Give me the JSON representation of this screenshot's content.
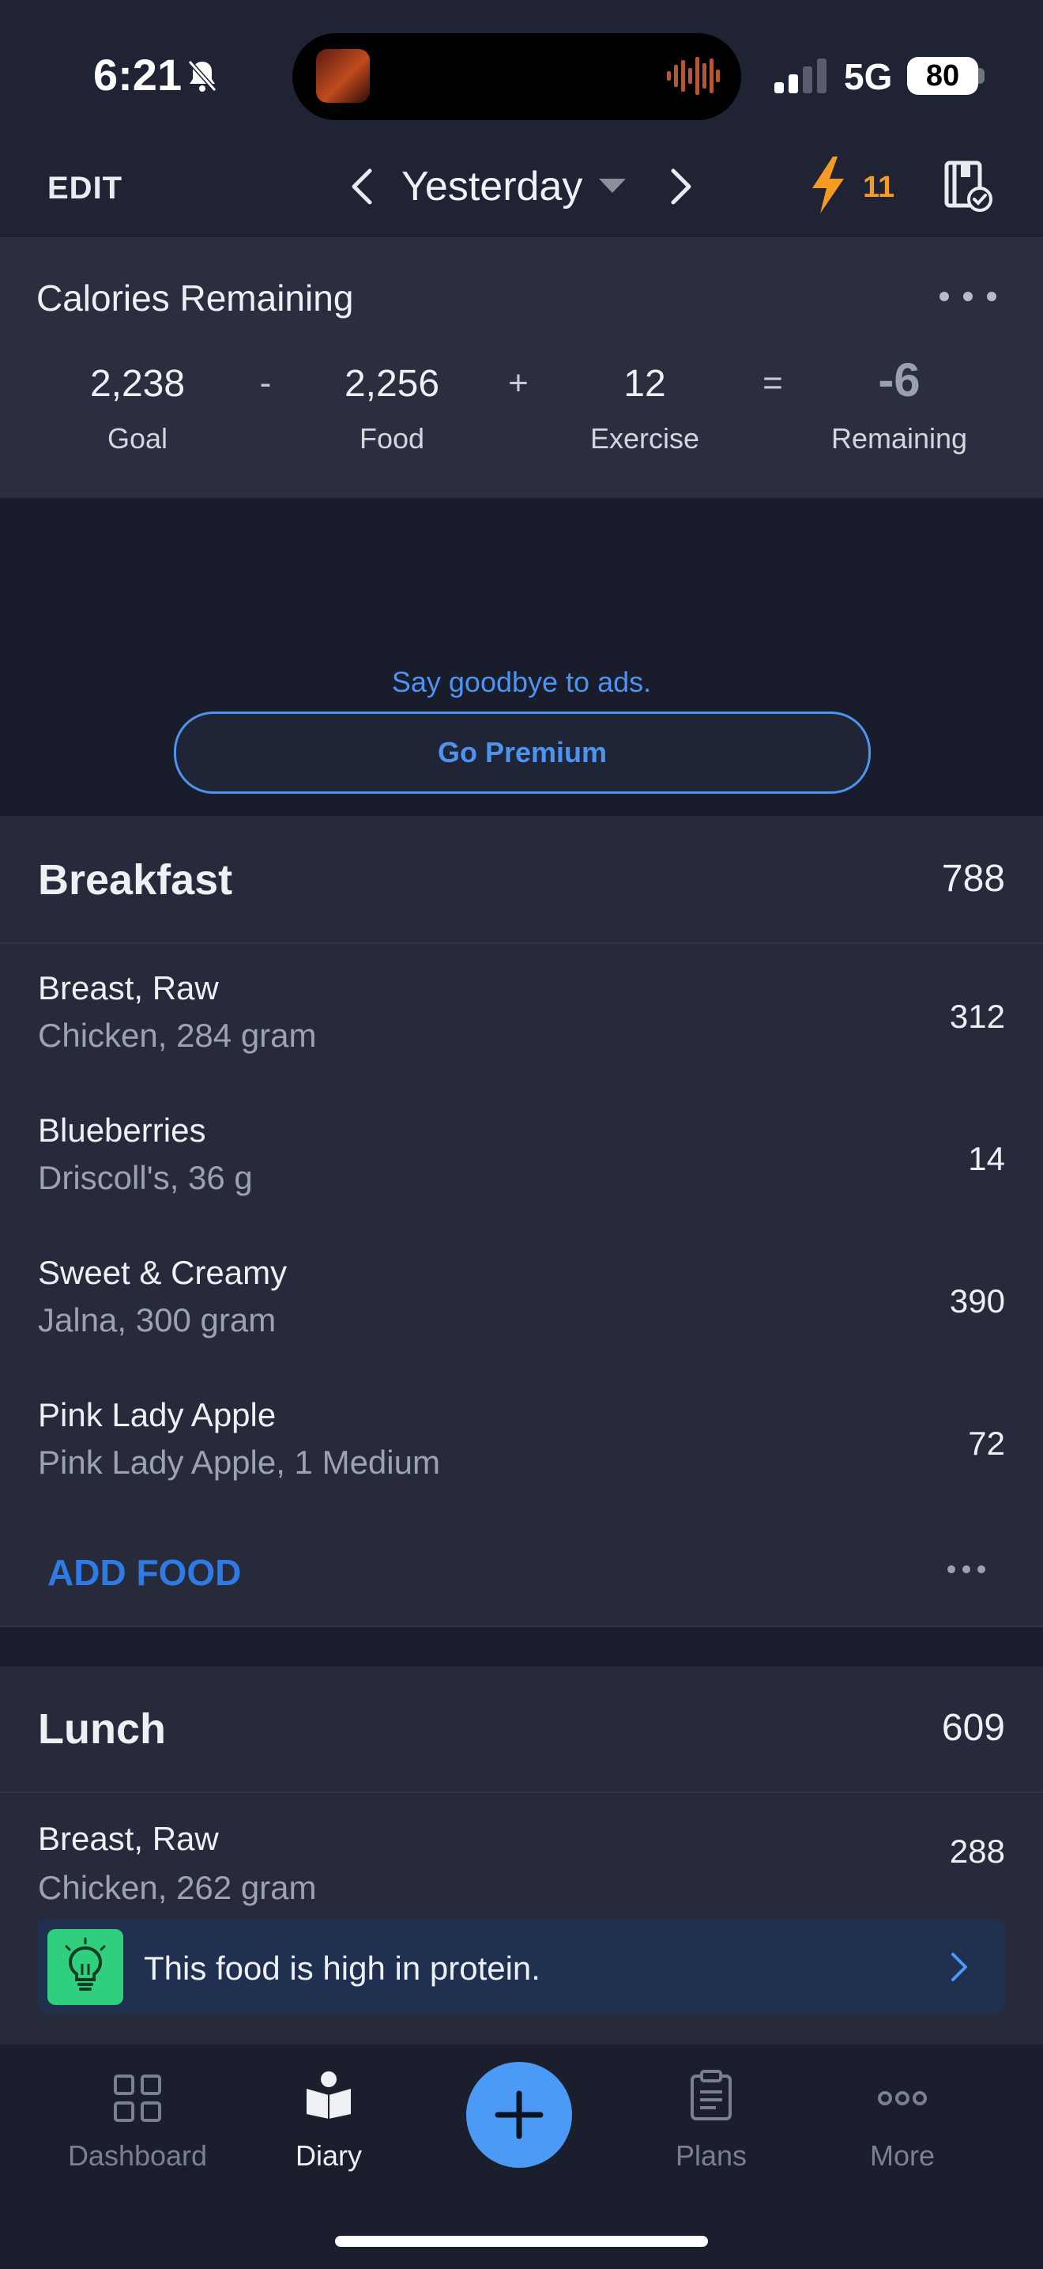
{
  "status_bar": {
    "time": "6:21",
    "network": "5G",
    "battery": "80"
  },
  "nav": {
    "edit_label": "EDIT",
    "date_label": "Yesterday",
    "streak_count": "11"
  },
  "calories": {
    "title": "Calories Remaining",
    "goal_value": "2,238",
    "goal_label": "Goal",
    "minus_op": "-",
    "food_value": "2,256",
    "food_label": "Food",
    "plus_op": "+",
    "exercise_value": "12",
    "exercise_label": "Exercise",
    "equals_op": "=",
    "remaining_value": "-6",
    "remaining_label": "Remaining"
  },
  "ad": {
    "text": "Say goodbye to ads.",
    "button_label": "Go Premium"
  },
  "breakfast": {
    "title": "Breakfast",
    "calories": "788",
    "items": [
      {
        "name": "Breast, Raw",
        "detail": "Chicken, 284 gram",
        "calories": "312"
      },
      {
        "name": "Blueberries",
        "detail": "Driscoll's, 36 g",
        "calories": "14"
      },
      {
        "name": "Sweet & Creamy",
        "detail": "Jalna, 300 gram",
        "calories": "390"
      },
      {
        "name": "Pink Lady Apple",
        "detail": "Pink Lady Apple, 1 Medium",
        "calories": "72"
      }
    ],
    "add_food_label": "ADD FOOD"
  },
  "lunch": {
    "title": "Lunch",
    "calories": "609",
    "items": [
      {
        "name": "Breast, Raw",
        "detail": "Chicken, 262 gram",
        "calories": "288"
      }
    ]
  },
  "tip": {
    "text": "This food is high in protein.",
    "icon": "lightbulb-icon"
  },
  "tab_bar": {
    "dashboard_label": "Dashboard",
    "diary_label": "Diary",
    "plans_label": "Plans",
    "more_label": "More"
  },
  "colors": {
    "accent_blue": "#4a9af6",
    "streak_orange": "#f59a23",
    "tip_green": "#2fcf7d",
    "background": "#181c2b",
    "card": "#272a3a"
  }
}
